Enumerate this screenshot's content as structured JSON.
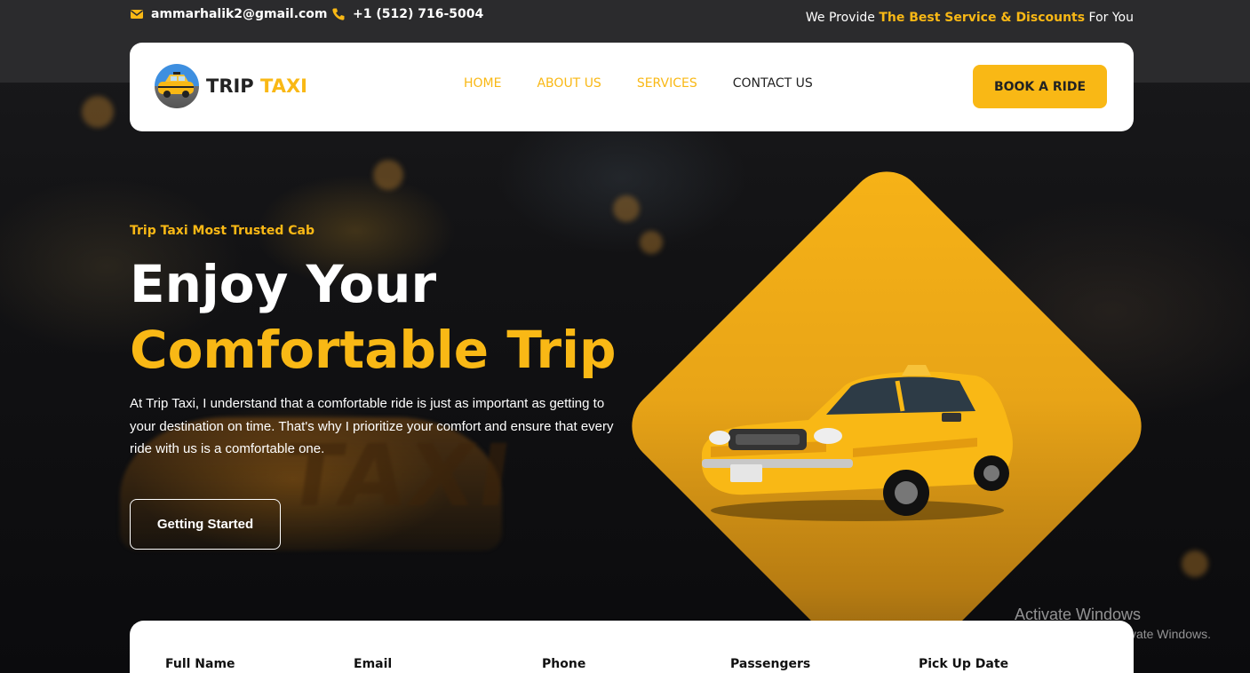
{
  "topbar": {
    "email": "ammarhalik2@gmail.com",
    "phone": "+1 (512) 716-5004",
    "promo_prefix": "We Provide",
    "promo_highlight": "The Best Service & Discounts",
    "promo_suffix": "For You",
    "email_icon": "envelope-icon",
    "phone_icon": "phone-icon"
  },
  "navbar": {
    "logo_word1": "TRIP",
    "logo_word2": "TAXI",
    "links": [
      {
        "label": "HOME"
      },
      {
        "label": "ABOUT US"
      },
      {
        "label": "SERVICES"
      },
      {
        "label": "CONTACT US"
      }
    ],
    "cta": "BOOK A RIDE"
  },
  "hero": {
    "eyebrow": "Trip Taxi Most Trusted Cab",
    "title_line1": "Enjoy Your",
    "title_line2": "Comfortable Trip",
    "description": "At Trip Taxi, I understand that a comfortable ride is just as important as getting to your destination on time. That's why I prioritize your comfort and ensure that every ride with us is a comfortable one.",
    "button": "Getting Started",
    "background_sign_text": "TAXI"
  },
  "booking_form": {
    "labels": [
      "Full Name",
      "Email",
      "Phone",
      "Passengers",
      "Pick Up Date"
    ]
  },
  "watermark": {
    "title": "Activate Windows",
    "subtitle": "Go to Settings to activate Windows."
  },
  "colors": {
    "accent": "#f9b815",
    "topbar": "#2b2b2d",
    "text_dark": "#222222"
  }
}
